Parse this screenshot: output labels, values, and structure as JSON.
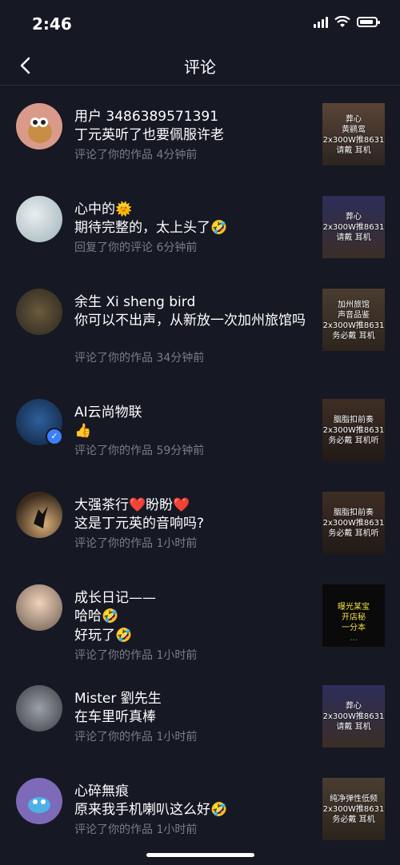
{
  "status": {
    "time": "2:46"
  },
  "nav": {
    "title": "评论"
  },
  "comments": [
    {
      "user": "用户 3486389571391",
      "text": "丁元英听了也要佩服许老",
      "meta": "评论了你的作品 4分钟前",
      "thumb_lines": [
        "葬心",
        "黄鹂鸾",
        "2x300W推8631",
        "请戴  耳机"
      ]
    },
    {
      "user": "心中的🌞",
      "text": "期待完整的，太上头了🤣",
      "meta": "回复了你的评论 6分钟前",
      "thumb_lines": [
        "葬心",
        "2x300W推8631",
        "请戴  耳机"
      ]
    },
    {
      "user": "余生 Xi sheng bird",
      "text": "你可以不出声，从新放一次加州旅馆吗",
      "meta": "评论了你的作品 34分钟前",
      "thumb_lines": [
        "加州旅馆",
        "声音品鉴",
        "2x300W推8631",
        "务必戴  耳机"
      ]
    },
    {
      "user": "AI云尚物联",
      "text": "👍",
      "meta": "评论了你的作品 59分钟前",
      "thumb_lines": [
        "胭脂扣前奏",
        "2x300W推8631",
        "务必戴  耳机听"
      ]
    },
    {
      "user": "大强茶行❤️盼盼❤️",
      "text": "这是丁元英的音响吗?",
      "meta": "评论了你的作品 1小时前",
      "thumb_lines": [
        "胭脂扣前奏",
        "2x300W推8631",
        "务必戴  耳机听"
      ]
    },
    {
      "user": "成长日记——",
      "text_lines": [
        "哈哈🤣",
        "好玩了🤣"
      ],
      "meta": "评论了你的作品 1小时前",
      "thumb_lines": [
        "曝光某宝",
        "开店秘",
        "一分本",
        "..."
      ]
    },
    {
      "user": "Mister 劉先生",
      "text": "在车里听真棒",
      "meta": "评论了你的作品 1小时前",
      "thumb_lines": [
        "葬心",
        "2x300W推8631",
        "请戴  耳机"
      ]
    },
    {
      "user": "心碎無痕",
      "text": "原来我手机喇叭这么好🤣",
      "meta": "评论了你的作品 1小时前",
      "thumb_lines": [
        "纯净弹性低频",
        "2x300W推8631",
        "务必戴  耳机"
      ]
    }
  ]
}
